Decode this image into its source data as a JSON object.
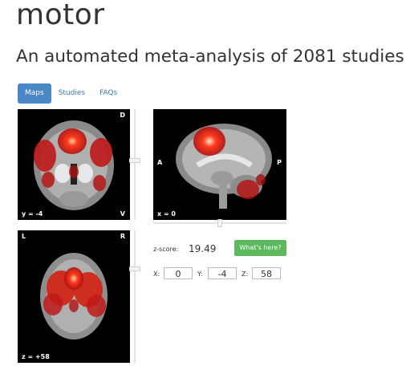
{
  "header": {
    "title": "motor",
    "subtitle": "An automated meta-analysis of 2081 studies"
  },
  "tabs": [
    {
      "label": "Maps",
      "active": true
    },
    {
      "label": "Studies",
      "active": false
    },
    {
      "label": "FAQs",
      "active": false
    }
  ],
  "viewer": {
    "coronal": {
      "top_right": "D",
      "bottom_left": "y = -4",
      "bottom_right": "V"
    },
    "sagittal": {
      "left": "A",
      "right": "P",
      "bottom_left": "x = 0"
    },
    "axial": {
      "top_left": "L",
      "top_right": "R",
      "bottom_left": "z = +58"
    }
  },
  "info": {
    "zscore_label": "z-score:",
    "zscore_value": "19.49",
    "whats_here_label": "What's here?",
    "x_label": "X:",
    "x_value": "0",
    "y_label": "Y:",
    "y_value": "-4",
    "z_label": "Z:",
    "z_value": "58"
  },
  "colors": {
    "tab_active": "#4a87c7",
    "link": "#3b78b4",
    "button_green": "#5cb85c",
    "activation_red": "#d42414"
  }
}
